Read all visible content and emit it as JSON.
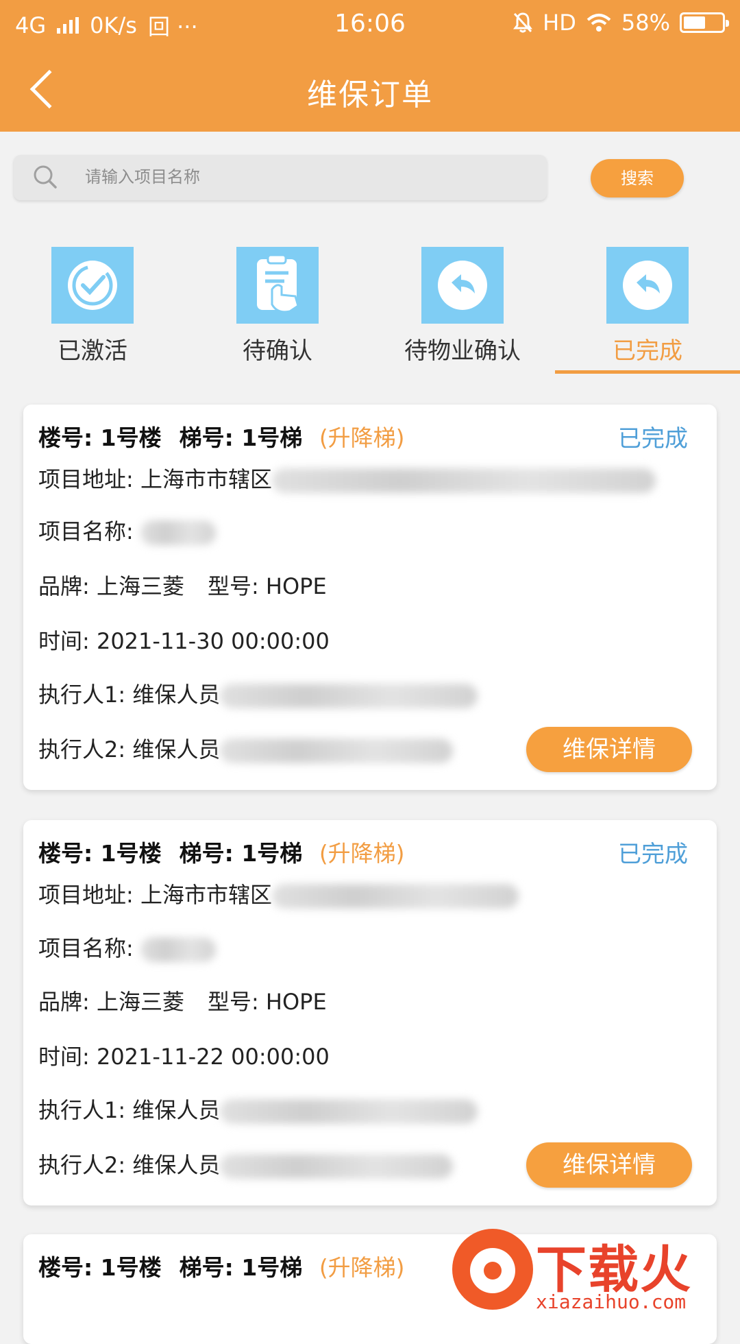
{
  "status_bar": {
    "network": "4G",
    "speed": "0K/s",
    "extra": "回 ···",
    "time": "16:06",
    "hd": "HD",
    "battery": "58%",
    "battery_level": 0.58
  },
  "header": {
    "title": "维保订单"
  },
  "search": {
    "placeholder": "请输入项目名称",
    "button_label": "搜索"
  },
  "tabs": [
    {
      "label": "已激活",
      "icon": "check-circle-icon"
    },
    {
      "label": "待确认",
      "icon": "clipboard-hand-icon"
    },
    {
      "label": "待物业确认",
      "icon": "reply-icon"
    },
    {
      "label": "已完成",
      "icon": "reply-icon",
      "active": true
    }
  ],
  "orders": [
    {
      "building": "楼号: 1号楼",
      "elevator": "梯号: 1号梯",
      "type": "(升降梯)",
      "status": "已完成",
      "address": "项目地址: 上海市市辖区",
      "name": "项目名称:",
      "brand": "品牌: 上海三菱",
      "model": "型号: HOPE",
      "time": "时间: 2021-11-30 00:00:00",
      "executor1": "执行人1: 维保人员",
      "executor2": "执行人2: 维保人员",
      "detail_label": "维保详情"
    },
    {
      "building": "楼号: 1号楼",
      "elevator": "梯号: 1号梯",
      "type": "(升降梯)",
      "status": "已完成",
      "address": "项目地址: 上海市市辖区",
      "name": "项目名称:",
      "brand": "品牌: 上海三菱",
      "model": "型号: HOPE",
      "time": "时间: 2021-11-22 00:00:00",
      "executor1": "执行人1: 维保人员",
      "executor2": "执行人2: 维保人员",
      "detail_label": "维保详情"
    },
    {
      "building": "楼号: 1号楼",
      "elevator": "梯号: 1号梯",
      "type": "(升降梯)"
    }
  ],
  "watermark": {
    "title": "下载火",
    "site": "xiazaihuo.com"
  },
  "colors": {
    "primary": "#f29d43",
    "status_blue": "#4f9fd8",
    "tab_icon_bg": "#7fcdf4"
  }
}
